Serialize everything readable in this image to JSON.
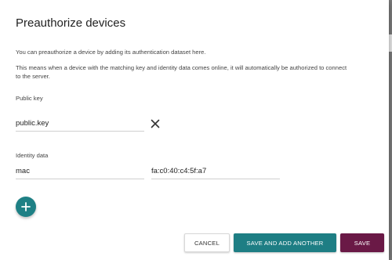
{
  "dialog": {
    "title": "Preauthorize devices",
    "description_1": "You can preauthorize a device by adding its authentication dataset here.",
    "description_2": "This means when a device with the matching key and identity data comes online, it will automatically be authorized to connect to the server."
  },
  "public_key": {
    "label": "Public key",
    "value": "public.key",
    "remove_icon": "close-icon"
  },
  "identity": {
    "label": "Identity data",
    "key": "mac",
    "value": "fa:c0:40:c4:5f:a7",
    "add_icon": "plus-icon"
  },
  "actions": {
    "cancel": "CANCEL",
    "save_and_add": "SAVE AND ADD ANOTHER",
    "save": "SAVE"
  },
  "colors": {
    "accent_teal": "#1e7e84",
    "primary_save": "#6a1946"
  }
}
